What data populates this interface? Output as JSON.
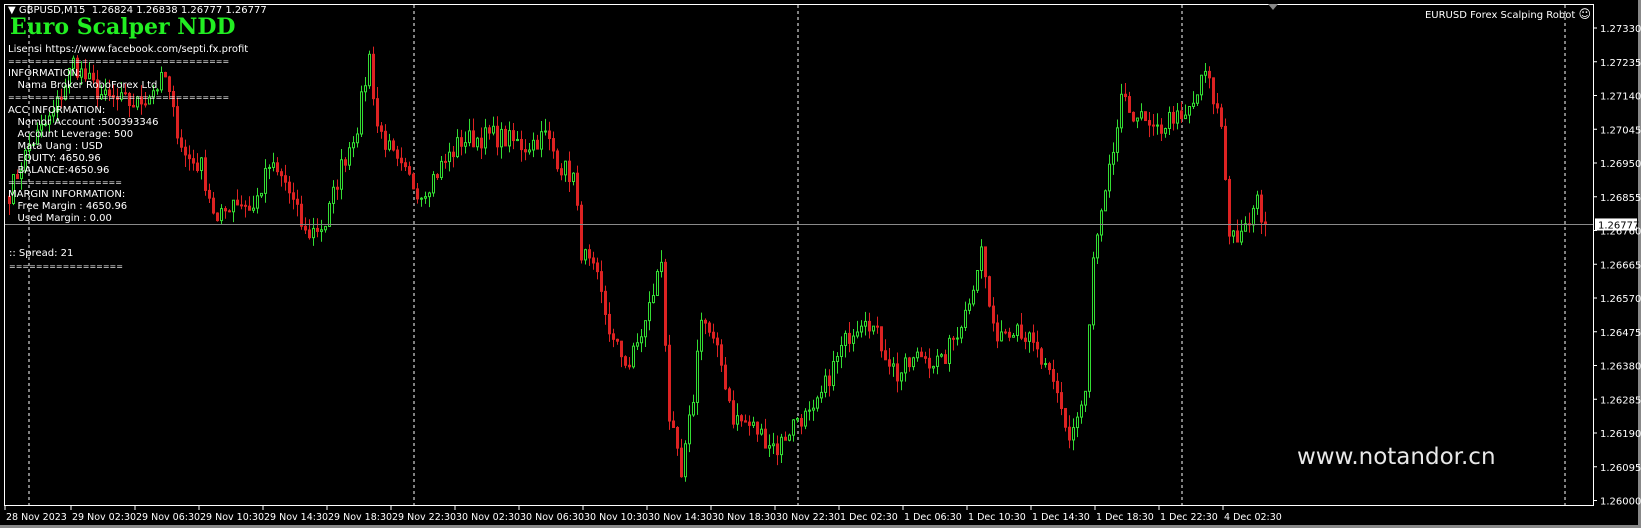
{
  "header": {
    "menu_icon": "triangle-down-icon",
    "symbol_line": "GBPUSD,M15  1.26824 1.26838 1.26777 1.26777"
  },
  "ea_name": "EURUSD Forex Scalping Robot",
  "ea_status_icon": "smiley-face-icon",
  "overlay": {
    "title": "Euro Scalper NDD",
    "lines": [
      "Lisensi https://www.facebook.com/septi.fx.profit",
      "=================================",
      "INFORMATION:",
      "   Nama Broker RoboForex Ltd",
      "=================================",
      "ACC INFORMATION:",
      "   Nomor Account :500393346",
      "   Account Leverage: 500",
      "   Mata Uang : USD",
      "   EQUITY: 4650.96",
      "   BALANCE:4650.96",
      "=================",
      "MARGIN INFORMATION:",
      "   Free Margin : 4650.96",
      "   Used Margin : 0.00"
    ],
    "spread": ":: Spread: 21",
    "spread_sep": "================="
  },
  "watermark": "www.notandor.cn",
  "colors": {
    "bull": "#33dd33",
    "bear": "#dd2222",
    "bid_line": "#8a8a8a",
    "background": "#000000",
    "axis": "#ffffff"
  },
  "chart_data": {
    "type": "candlestick",
    "symbol": "GBPUSD",
    "timeframe": "M15",
    "current_price": "1.26777",
    "ylim": [
      1.26,
      1.2733
    ],
    "price_ticks": [
      "1.27330",
      "1.27235",
      "1.27140",
      "1.27045",
      "1.26950",
      "1.26855",
      "1.26760",
      "1.26665",
      "1.26570",
      "1.26475",
      "1.26380",
      "1.26285",
      "1.26190",
      "1.26095",
      "1.26000"
    ],
    "time_ticks": [
      "28 Nov 2023",
      "29 Nov 02:30",
      "29 Nov 06:30",
      "29 Nov 10:30",
      "29 Nov 14:30",
      "29 Nov 18:30",
      "29 Nov 22:30",
      "30 Nov 02:30",
      "30 Nov 06:30",
      "30 Nov 10:30",
      "30 Nov 14:30",
      "30 Nov 18:30",
      "30 Nov 22:30",
      "1 Dec 02:30",
      "1 Dec 06:30",
      "1 Dec 10:30",
      "1 Dec 14:30",
      "1 Dec 18:30",
      "1 Dec 22:30",
      "4 Dec 02:30"
    ],
    "bars_per_tick": 16,
    "close_path_by_bar": [
      [
        0,
        1.26866
      ],
      [
        5,
        1.26998
      ],
      [
        11,
        1.27086
      ],
      [
        16,
        1.27233
      ],
      [
        19,
        1.27189
      ],
      [
        24,
        1.2713
      ],
      [
        32,
        1.27116
      ],
      [
        39,
        1.27189
      ],
      [
        41,
        1.27086
      ],
      [
        44,
        1.26969
      ],
      [
        48,
        1.2694
      ],
      [
        52,
        1.26778
      ],
      [
        56,
        1.26851
      ],
      [
        61,
        1.26821
      ],
      [
        65,
        1.2694
      ],
      [
        69,
        1.26895
      ],
      [
        74,
        1.26749
      ],
      [
        79,
        1.26778
      ],
      [
        83,
        1.2694
      ],
      [
        87,
        1.27057
      ],
      [
        90,
        1.27248
      ],
      [
        92,
        1.27057
      ],
      [
        97,
        1.2694
      ],
      [
        103,
        1.26866
      ],
      [
        108,
        1.2694
      ],
      [
        113,
        1.27013
      ],
      [
        121,
        1.27028
      ],
      [
        129,
        1.26998
      ],
      [
        134,
        1.27028
      ],
      [
        138,
        1.2694
      ],
      [
        141,
        1.2691
      ],
      [
        143,
        1.26705
      ],
      [
        147,
        1.26617
      ],
      [
        151,
        1.2644
      ],
      [
        155,
        1.26382
      ],
      [
        159,
        1.26499
      ],
      [
        163,
        1.26675
      ],
      [
        165,
        1.26235
      ],
      [
        168,
        1.26059
      ],
      [
        171,
        1.26294
      ],
      [
        173,
        1.26529
      ],
      [
        178,
        1.26382
      ],
      [
        181,
        1.26235
      ],
      [
        186,
        1.26205
      ],
      [
        192,
        1.26147
      ],
      [
        197,
        1.26235
      ],
      [
        201,
        1.26235
      ],
      [
        205,
        1.26352
      ],
      [
        210,
        1.2647
      ],
      [
        214,
        1.26529
      ],
      [
        218,
        1.2644
      ],
      [
        222,
        1.26352
      ],
      [
        228,
        1.26411
      ],
      [
        233,
        1.26382
      ],
      [
        239,
        1.26529
      ],
      [
        243,
        1.26705
      ],
      [
        246,
        1.2647
      ],
      [
        252,
        1.26499
      ],
      [
        257,
        1.26411
      ],
      [
        262,
        1.26294
      ],
      [
        265,
        1.26176
      ],
      [
        269,
        1.26294
      ],
      [
        271,
        1.26675
      ],
      [
        274,
        1.26851
      ],
      [
        278,
        1.27116
      ],
      [
        282,
        1.27086
      ],
      [
        286,
        1.27028
      ],
      [
        291,
        1.27086
      ],
      [
        293,
        1.27057
      ],
      [
        296,
        1.27116
      ],
      [
        299,
        1.27204
      ],
      [
        303,
        1.27057
      ],
      [
        305,
        1.26763
      ],
      [
        308,
        1.26734
      ],
      [
        312,
        1.26837
      ],
      [
        314,
        1.26777
      ]
    ]
  }
}
